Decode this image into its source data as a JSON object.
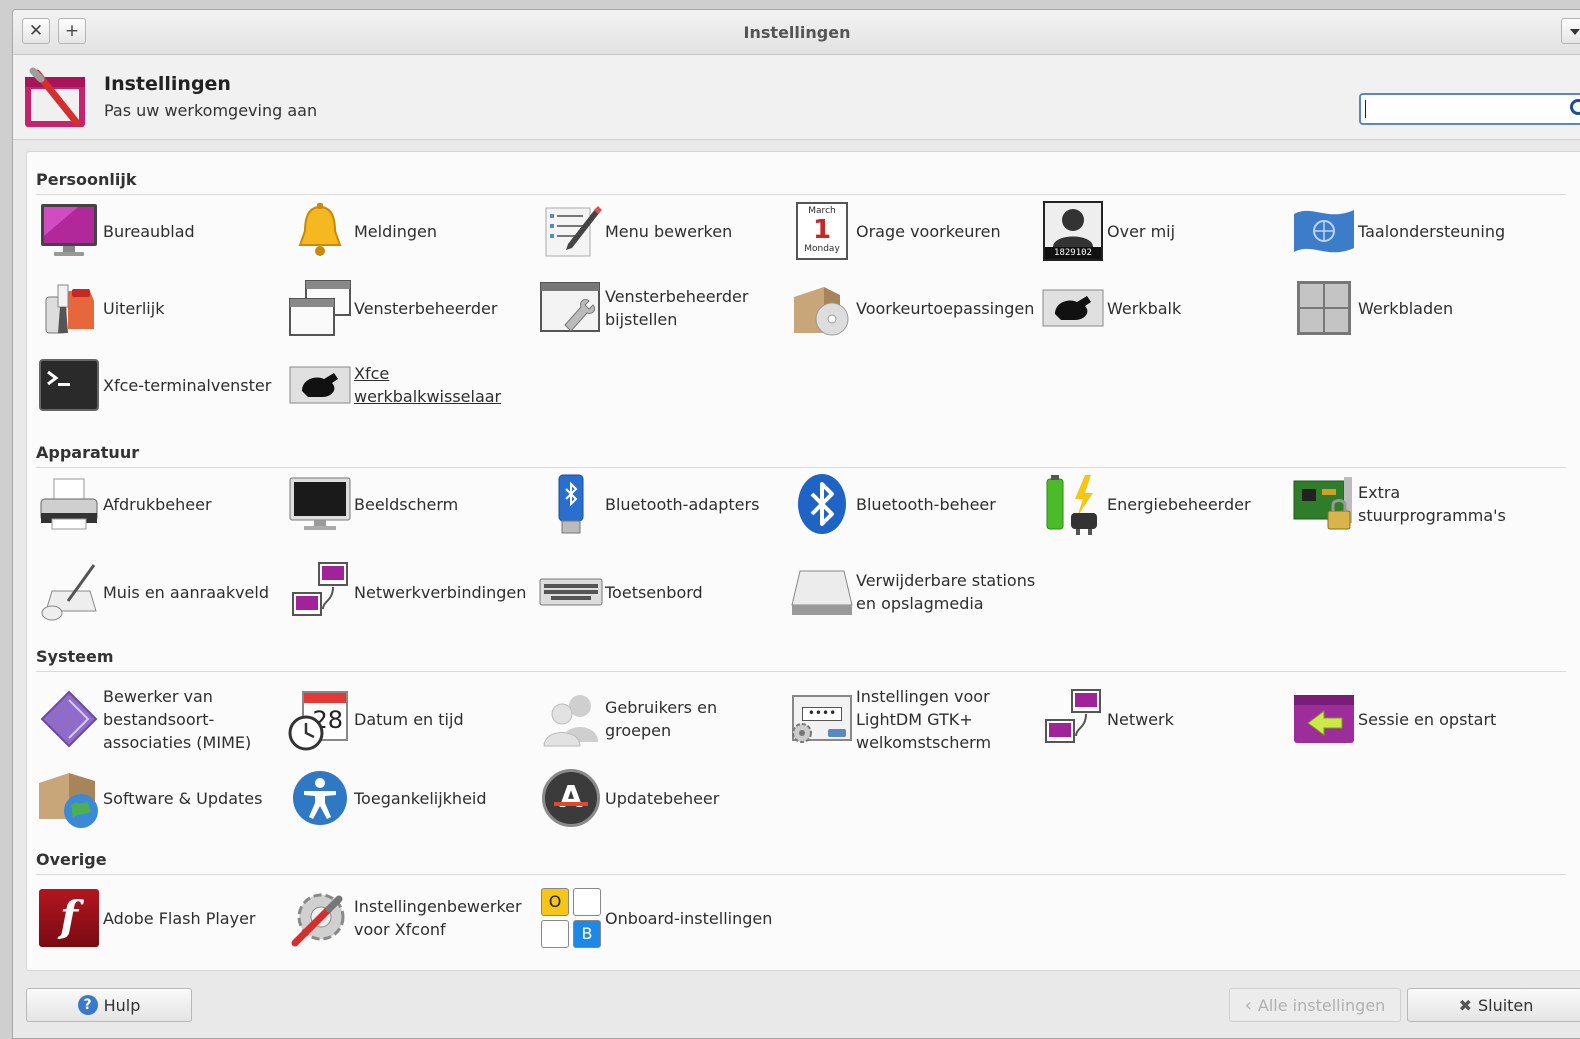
{
  "window": {
    "title": "Instellingen",
    "close_glyph": "✕",
    "add_glyph": "+"
  },
  "header": {
    "title": "Instellingen",
    "subtitle": "Pas uw werkomgeving aan",
    "search_value": ""
  },
  "sections": {
    "persoonlijk": {
      "title": "Persoonlijk",
      "items": [
        {
          "label": "Bureaublad",
          "icon": "desktop-icon"
        },
        {
          "label": "Meldingen",
          "icon": "bell-icon"
        },
        {
          "label": "Menu bewerken",
          "icon": "menu-edit-icon"
        },
        {
          "label": "Orage voorkeuren",
          "icon": "calendar-icon",
          "cal_month": "March",
          "cal_day": "1",
          "cal_weekday": "Monday"
        },
        {
          "label": "Over mij",
          "icon": "user-photo-icon",
          "badge": "1829102"
        },
        {
          "label": "Taalondersteuning",
          "icon": "language-flag-icon"
        },
        {
          "label": "Uiterlijk",
          "icon": "appearance-icon"
        },
        {
          "label": "Vensterbeheerder",
          "icon": "window-manager-icon"
        },
        {
          "label": "Vensterbeheerder bijstellen",
          "icon": "window-tweaks-icon"
        },
        {
          "label": "Voorkeurtoepassingen",
          "icon": "preferred-apps-icon"
        },
        {
          "label": "Werkbalk",
          "icon": "panel-mouse-icon"
        },
        {
          "label": "Werkbladen",
          "icon": "workspaces-icon"
        },
        {
          "label": "Xfce-terminalvenster",
          "icon": "terminal-icon"
        },
        {
          "label": "Xfce werkbalkwisselaar",
          "icon": "panel-switch-icon"
        }
      ]
    },
    "apparatuur": {
      "title": "Apparatuur",
      "items": [
        {
          "label": "Afdrukbeheer",
          "icon": "printer-icon"
        },
        {
          "label": "Beeldscherm",
          "icon": "monitor-icon"
        },
        {
          "label": "Bluetooth-adapters",
          "icon": "bluetooth-adapter-icon"
        },
        {
          "label": "Bluetooth-beheer",
          "icon": "bluetooth-icon"
        },
        {
          "label": "Energiebeheerder",
          "icon": "battery-plug-icon"
        },
        {
          "label": "Extra stuurprogramma's",
          "icon": "driver-card-icon"
        },
        {
          "label": "Muis en aanraakveld",
          "icon": "mouse-touchpad-icon"
        },
        {
          "label": "Netwerkverbindingen",
          "icon": "network-connections-icon"
        },
        {
          "label": "Toetsenbord",
          "icon": "keyboard-icon"
        },
        {
          "label": "Verwijderbare stations en opslagmedia",
          "icon": "removable-drive-icon"
        }
      ]
    },
    "systeem": {
      "title": "Systeem",
      "items": [
        {
          "label": "Bewerker van bestandsoort-associaties (MIME)",
          "icon": "mime-editor-icon"
        },
        {
          "label": "Datum en tijd",
          "icon": "date-time-icon",
          "cal_day": "28"
        },
        {
          "label": "Gebruikers en groepen",
          "icon": "users-groups-icon"
        },
        {
          "label": "Instellingen voor LightDM GTK+ welkomstscherm",
          "icon": "lightdm-icon",
          "pw_dots": "••••"
        },
        {
          "label": "Netwerk",
          "icon": "network-icon"
        },
        {
          "label": "Sessie en opstart",
          "icon": "session-startup-icon"
        },
        {
          "label": "Software & Updates",
          "icon": "software-updates-icon"
        },
        {
          "label": "Toegankelijkheid",
          "icon": "accessibility-icon"
        },
        {
          "label": "Updatebeheer",
          "icon": "update-manager-icon",
          "glyph": "A"
        }
      ]
    },
    "overige": {
      "title": "Overige",
      "items": [
        {
          "label": "Adobe Flash Player",
          "icon": "flash-player-icon",
          "glyph": "f"
        },
        {
          "label": "Instellingenbewerker voor Xfconf",
          "icon": "settings-editor-icon"
        },
        {
          "label": "Onboard-instellingen",
          "icon": "onboard-keyboard-icon",
          "key1": "O",
          "key2": "B"
        }
      ]
    }
  },
  "footer": {
    "help_label": "Hulp",
    "help_glyph": "?",
    "all_settings_label": "Alle instellingen",
    "close_label": "Sluiten",
    "close_glyph": "✖"
  },
  "colors": {
    "accent": "#5b87c2",
    "flash": "#a4121c",
    "bluetooth": "#1f63c4"
  }
}
